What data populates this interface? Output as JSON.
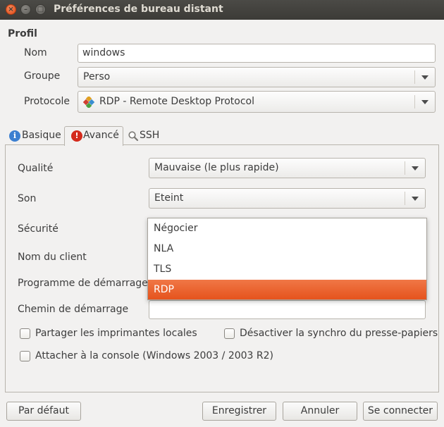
{
  "window": {
    "title": "Préférences de bureau distant"
  },
  "profile": {
    "section_title": "Profil",
    "name_label": "Nom",
    "name_value": "windows",
    "group_label": "Groupe",
    "group_value": "Perso",
    "protocol_label": "Protocole",
    "protocol_value": "RDP - Remote Desktop Protocol"
  },
  "tabs": [
    {
      "label": "Basique",
      "icon": "info-icon"
    },
    {
      "label": "Avancé",
      "icon": "warning-icon",
      "active": true
    },
    {
      "label": "SSH",
      "icon": "magnifier-icon"
    }
  ],
  "advanced": {
    "quality_label": "Qualité",
    "quality_value": "Mauvaise (le plus rapide)",
    "sound_label": "Son",
    "sound_value": "Eteint",
    "security_label": "Sécurité",
    "client_name_label": "Nom du client",
    "startup_program_label": "Programme de démarrage",
    "startup_path_label": "Chemin de démarrage",
    "startup_path_value": "",
    "share_printers_label": "Partager les imprimantes locales",
    "disable_clipboard_label": "Désactiver la synchro du presse-papiers",
    "attach_console_label": "Attacher à la console (Windows 2003 / 2003 R2)"
  },
  "security_dropdown": {
    "options": [
      "Négocier",
      "NLA",
      "TLS",
      "RDP"
    ],
    "selected": "RDP"
  },
  "buttons": {
    "default": "Par défaut",
    "save": "Enregistrer",
    "cancel": "Annuler",
    "connect": "Se connecter"
  },
  "colors": {
    "accent": "#e95420",
    "titlebar": "#3c3b37"
  }
}
